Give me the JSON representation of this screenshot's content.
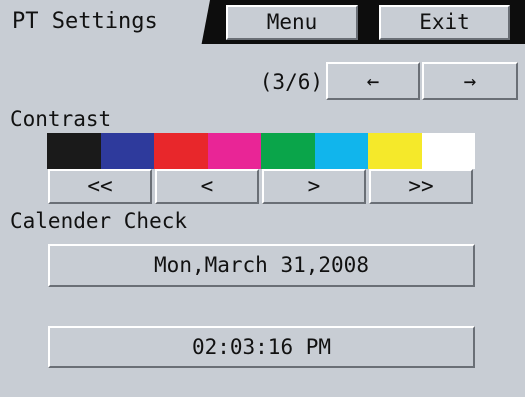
{
  "header": {
    "title": "PT Settings",
    "menu_label": "Menu",
    "exit_label": "Exit"
  },
  "pager": {
    "indicator": "(3/6)",
    "prev_label": "←",
    "next_label": "→"
  },
  "contrast": {
    "label": "Contrast",
    "colors": [
      "#1a1a1a",
      "#2e3a9c",
      "#e8272b",
      "#e92596",
      "#0aa54a",
      "#11b5ec",
      "#f5e92a",
      "#ffffff"
    ],
    "buttons": [
      "<<",
      "<",
      ">",
      ">>"
    ]
  },
  "calendar": {
    "label": "Calender Check",
    "date": "Mon,March 31,2008",
    "time": "02:03:16 PM"
  }
}
